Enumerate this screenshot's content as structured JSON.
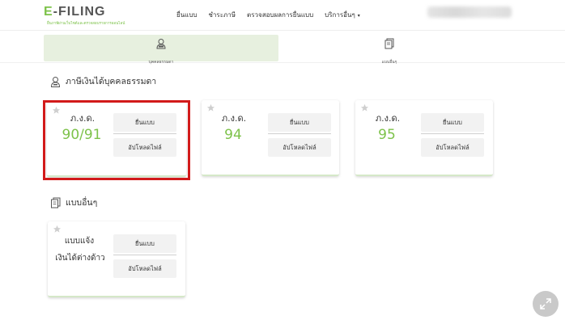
{
  "logo": {
    "e": "E",
    "rest": "-FILING",
    "tagline": "ยื่นภาษีผ่านเว็บไซต์และตรวจสอบรายการออนไลน์"
  },
  "nav": {
    "items": [
      "ยื่นแบบ",
      "ชำระภาษี",
      "ตรวจสอบผลการยื่นแบบ",
      "บริการอื่นๆ"
    ],
    "caret": "▾"
  },
  "tabs": [
    {
      "label": "บุคคลธรรมดา",
      "icon": "person-icon",
      "active": true
    },
    {
      "label": "แบบอื่นๆ",
      "icon": "documents-icon",
      "active": false
    }
  ],
  "sections": {
    "personal": "ภาษีเงินได้บุคคลธรรมดา",
    "other": "แบบอื่นๆ"
  },
  "cards": [
    {
      "label": "ภ.ง.ด.",
      "number": "90/91",
      "submit": "ยื่นแบบ",
      "upload": "อัปโหลดไฟล์"
    },
    {
      "label": "ภ.ง.ด.",
      "number": "94",
      "submit": "ยื่นแบบ",
      "upload": "อัปโหลดไฟล์"
    },
    {
      "label": "ภ.ง.ด.",
      "number": "95",
      "submit": "ยื่นแบบ",
      "upload": "อัปโหลดไฟล์"
    }
  ],
  "other_card": {
    "line1": "แบบแจ้ง",
    "line2": "เงินได้ต่างด้าว",
    "submit": "ยื่นแบบ",
    "upload": "อัปโหลดไฟล์"
  },
  "colors": {
    "accent": "#7dc24a",
    "highlight": "#d21a1a",
    "tab_active": "#e7f0df"
  }
}
